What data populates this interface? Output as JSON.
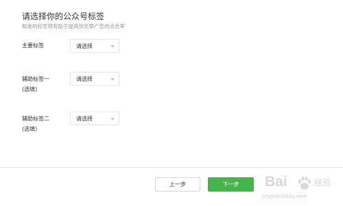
{
  "header": {
    "title": "请选择你的公众号标签",
    "subtitle": "精准的标签将有助于提高你文章广告的点击率"
  },
  "fields": [
    {
      "label_line1": "主要标签",
      "label_line2": "",
      "select_value": "请选择"
    },
    {
      "label_line1": "辅助标签一",
      "label_line2": "(选填)",
      "select_value": "请选择"
    },
    {
      "label_line1": "辅助标签二",
      "label_line2": "(选填)",
      "select_value": "请选择"
    }
  ],
  "footer": {
    "prev_label": "上一步",
    "next_label": "下一步"
  },
  "watermark": {
    "brand": "Bai",
    "brand_suffix": "经验",
    "url": "jingyan.baidu.com",
    "icon": "paw-icon"
  },
  "colors": {
    "primary_green": "#44b549",
    "border": "#e4e8eb",
    "muted_text": "#999999"
  }
}
